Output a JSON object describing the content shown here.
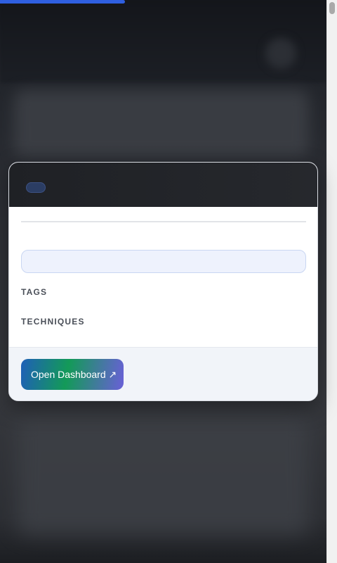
{
  "modal": {
    "search": {
      "value": "",
      "placeholder": ""
    },
    "sections": {
      "tags_label": "TAGS",
      "techniques_label": "TECHNIQUES"
    },
    "footer": {
      "dashboard_button_label": "Open Dashboard ↗"
    }
  },
  "progress": {
    "fraction": 0.37
  },
  "colors": {
    "accent": "#2f5fe0",
    "modal_header": "#1f2125",
    "input_bg": "#eef2fd",
    "footer_bg": "#f1f4f9",
    "button_gradient": [
      "#1f5fb8",
      "#139a58",
      "#6a5fd8"
    ]
  }
}
